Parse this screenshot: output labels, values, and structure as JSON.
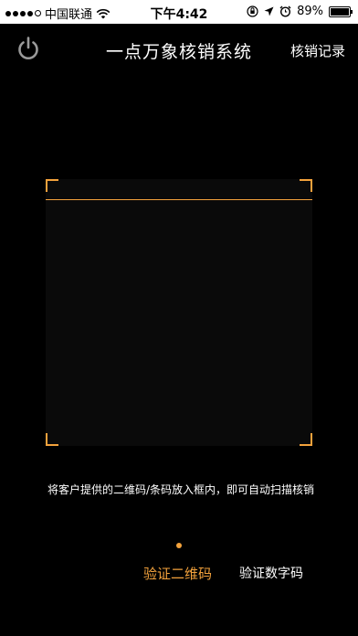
{
  "status_bar": {
    "carrier": "中国联通",
    "time": "下午4:42",
    "battery_percent": "89%",
    "battery_level": 0.89
  },
  "header": {
    "title": "一点万象核销系统",
    "history_label": "核销记录"
  },
  "scanner": {
    "hint": "将客户提供的二维码/条码放入框内，即可自动扫描核销"
  },
  "modes": {
    "qr_label": "验证二维码",
    "digit_label": "验证数字码"
  },
  "colors": {
    "accent": "#f3a23c",
    "background": "#000000"
  }
}
